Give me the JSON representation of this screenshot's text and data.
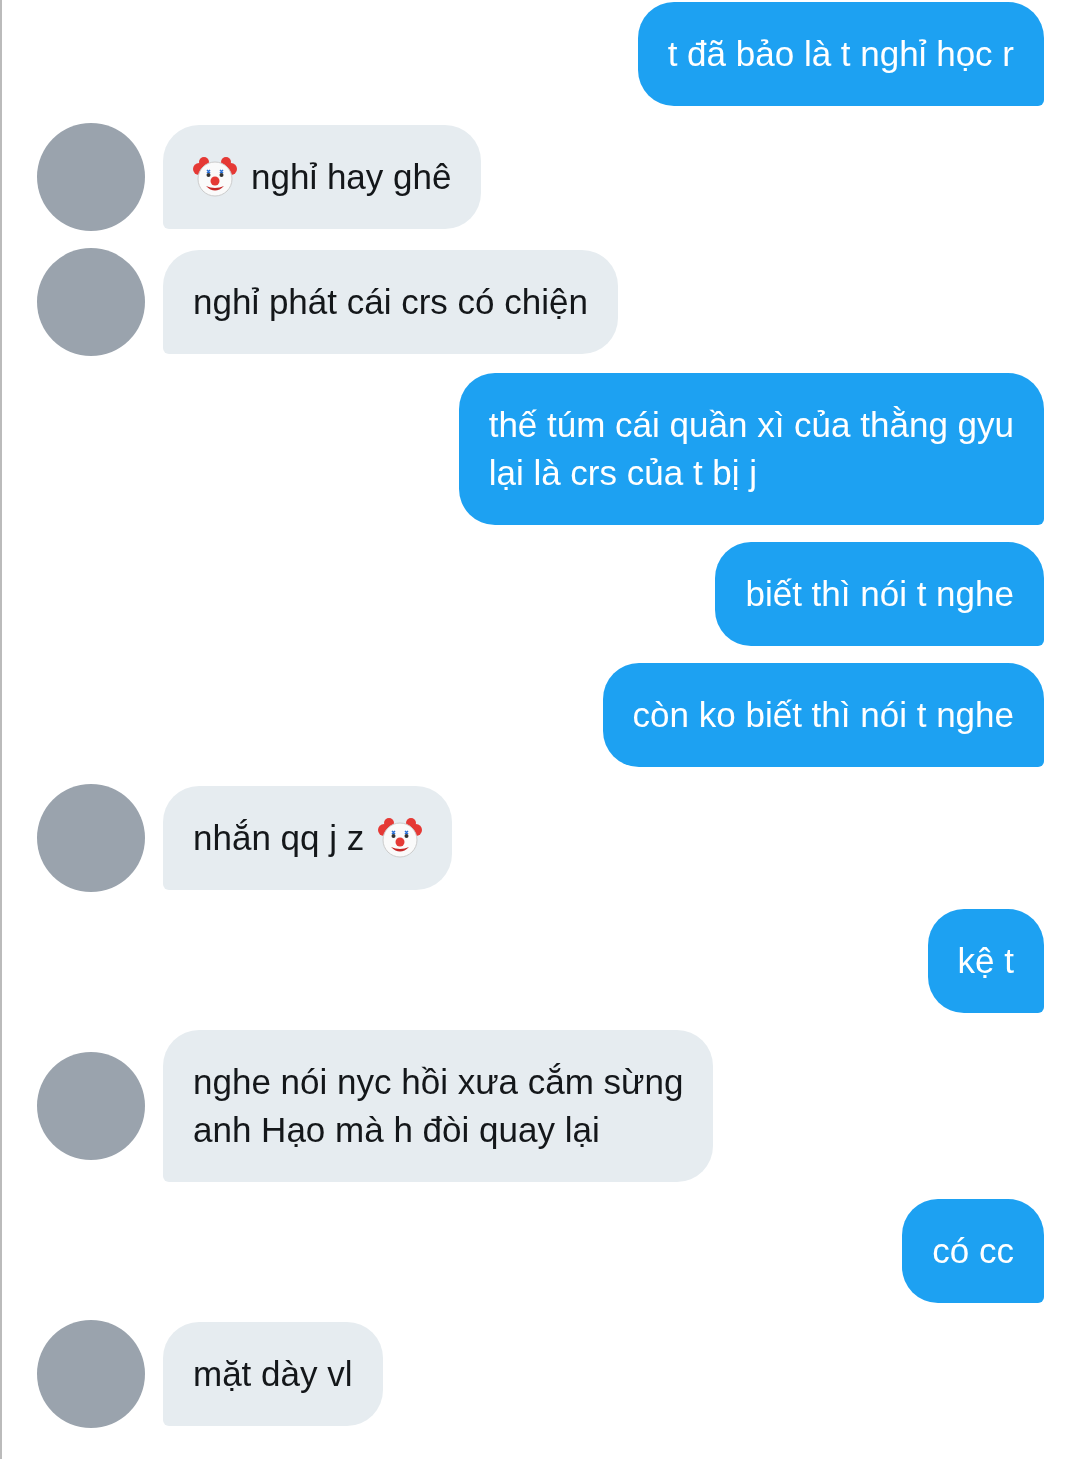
{
  "messages": [
    {
      "kind": "outgoing",
      "parts": [
        {
          "kind": "text",
          "text": "t đã bảo là t nghỉ học r"
        }
      ]
    },
    {
      "kind": "incoming",
      "parts": [
        {
          "kind": "emoji"
        },
        {
          "kind": "text",
          "text": "nghỉ hay ghê"
        }
      ]
    },
    {
      "kind": "incoming",
      "parts": [
        {
          "kind": "text",
          "text": "nghỉ phát cái crs có chiện"
        }
      ]
    },
    {
      "kind": "outgoing",
      "parts": [
        {
          "kind": "text",
          "text": "thế túm cái quần xì của thằng gyu\nlại là crs của t bị j"
        }
      ]
    },
    {
      "kind": "outgoing",
      "parts": [
        {
          "kind": "text",
          "text": "biết thì nói t nghe"
        }
      ]
    },
    {
      "kind": "outgoing",
      "parts": [
        {
          "kind": "text",
          "text": "còn ko biết thì nói t nghe"
        }
      ]
    },
    {
      "kind": "incoming",
      "parts": [
        {
          "kind": "text",
          "text": "nhắn qq j z"
        },
        {
          "kind": "emoji"
        }
      ]
    },
    {
      "kind": "outgoing",
      "parts": [
        {
          "kind": "text",
          "text": "kệ t"
        }
      ]
    },
    {
      "kind": "incoming",
      "parts": [
        {
          "kind": "text",
          "text": "nghe nói nyc hồi xưa cắm sừng\nanh Hạo mà h đòi quay lại"
        }
      ]
    },
    {
      "kind": "outgoing",
      "parts": [
        {
          "kind": "text",
          "text": "có cc"
        }
      ]
    },
    {
      "kind": "incoming",
      "parts": [
        {
          "kind": "text",
          "text": "mặt dày vl"
        }
      ]
    }
  ]
}
